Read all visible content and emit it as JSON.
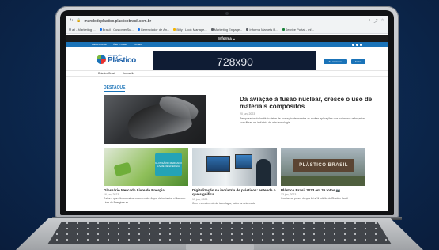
{
  "browser": {
    "url": "mundodoplastico.plasticobrasil.com.br",
    "bookmarks": [
      {
        "label": "all - Marketing ...",
        "color": "#9aa0a6"
      },
      {
        "label": "Brasil - CustomerSu...",
        "color": "#1a73e8"
      },
      {
        "label": "Gerenciador de An...",
        "color": "#1a73e8"
      },
      {
        "label": "Billy | Look Manage...",
        "color": "#f4b400"
      },
      {
        "label": "Marketing Engage...",
        "color": "#5f6368"
      },
      {
        "label": "Informa Markets R...",
        "color": "#5f6368"
      },
      {
        "label": "Service Portal - Inf...",
        "color": "#188038"
      }
    ]
  },
  "informa_bar": {
    "label": "Informa ⌄"
  },
  "site_top": {
    "links": [
      "Plástico Brasil",
      "Óleo e Gases",
      "Contato"
    ]
  },
  "header": {
    "logo_small": "mundo do",
    "logo_big": "Plástico",
    "ad_label": "728x90",
    "buttons": [
      "Se inscrever",
      "Entrar"
    ]
  },
  "nav": {
    "items": [
      "Plástico Brasil",
      "Inovação"
    ]
  },
  "content": {
    "section_label": "DESTAQUE",
    "hero": {
      "title": "Da aviação à fusão nuclear, cresce o uso de materiais compósitos",
      "date": "20 jun, 2023",
      "desc": "Pesquisador do Instituto deixe de inovação demonstra as muitas aplicações dos polímeros reforçados com fibras na indústria de alta tecnologia"
    },
    "cards": [
      {
        "title": "Glossário Mercado Livre de Energia",
        "date": "16 jun, 2023",
        "desc": "Saiba o que são conceitos como o valor Arque da indústria, o Mercado Livre de Energia e as",
        "image_text": "GLOSSÁRIO MERCADO LIVRE DE ENERGIA"
      },
      {
        "title": "Digitalização na indústria de plásticos: entenda o que significa",
        "date": "13 jun, 2023",
        "desc": "Com o crescimento da tecnologia, todos os setores de"
      },
      {
        "title": "Plástico Brasil 2023 em 35 fotos 📷",
        "date": "13 jun, 2023",
        "desc": "Confira um pouco do que foi a 1ª edição do Plástico Brasil",
        "image_text": "PLÁSTICO BRASIL"
      }
    ]
  }
}
